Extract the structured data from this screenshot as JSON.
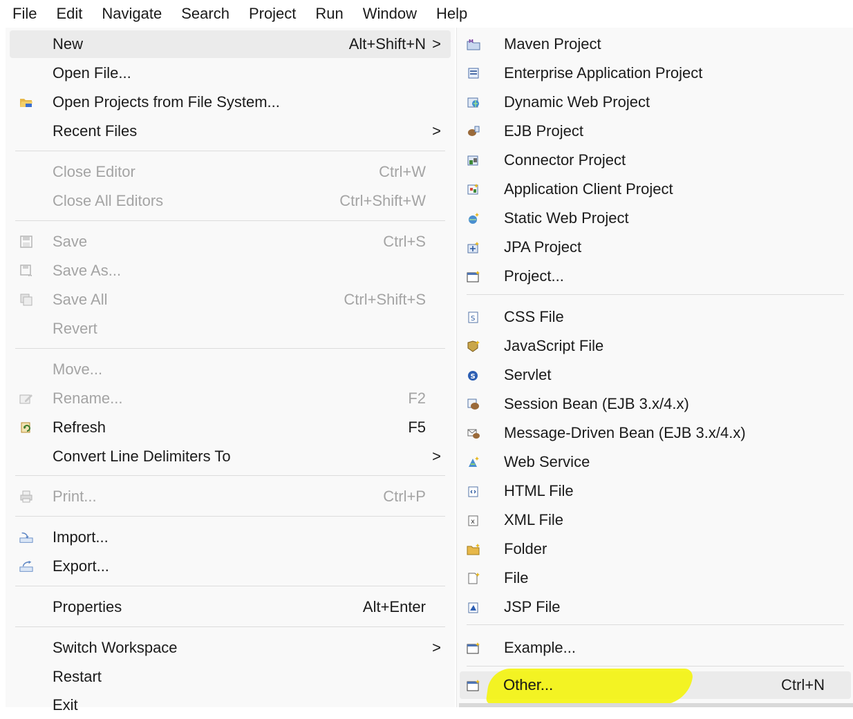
{
  "menubar": [
    "File",
    "Edit",
    "Navigate",
    "Search",
    "Project",
    "Run",
    "Window",
    "Help"
  ],
  "file_menu": {
    "new": {
      "label": "New",
      "shortcut": "Alt+Shift+N"
    },
    "open_file": {
      "label": "Open File..."
    },
    "open_projects": {
      "label": "Open Projects from File System..."
    },
    "recent_files": {
      "label": "Recent Files"
    },
    "close_editor": {
      "label": "Close Editor",
      "shortcut": "Ctrl+W"
    },
    "close_all": {
      "label": "Close All Editors",
      "shortcut": "Ctrl+Shift+W"
    },
    "save": {
      "label": "Save",
      "shortcut": "Ctrl+S"
    },
    "save_as": {
      "label": "Save As..."
    },
    "save_all": {
      "label": "Save All",
      "shortcut": "Ctrl+Shift+S"
    },
    "revert": {
      "label": "Revert"
    },
    "move": {
      "label": "Move..."
    },
    "rename": {
      "label": "Rename...",
      "shortcut": "F2"
    },
    "refresh": {
      "label": "Refresh",
      "shortcut": "F5"
    },
    "convert": {
      "label": "Convert Line Delimiters To"
    },
    "print": {
      "label": "Print...",
      "shortcut": "Ctrl+P"
    },
    "import": {
      "label": "Import..."
    },
    "export": {
      "label": "Export..."
    },
    "properties": {
      "label": "Properties",
      "shortcut": "Alt+Enter"
    },
    "switch_workspace": {
      "label": "Switch Workspace"
    },
    "restart": {
      "label": "Restart"
    },
    "exit": {
      "label": "Exit"
    }
  },
  "new_submenu": {
    "maven": {
      "label": "Maven Project"
    },
    "enterprise": {
      "label": "Enterprise Application Project"
    },
    "dynamic_web": {
      "label": "Dynamic Web Project"
    },
    "ejb": {
      "label": "EJB Project"
    },
    "connector": {
      "label": "Connector Project"
    },
    "app_client": {
      "label": "Application Client Project"
    },
    "static_web": {
      "label": "Static Web Project"
    },
    "jpa": {
      "label": "JPA Project"
    },
    "project": {
      "label": "Project..."
    },
    "css": {
      "label": "CSS File"
    },
    "javascript": {
      "label": "JavaScript File"
    },
    "servlet": {
      "label": "Servlet"
    },
    "session_bean": {
      "label": "Session Bean (EJB 3.x/4.x)"
    },
    "mdb": {
      "label": "Message-Driven Bean (EJB 3.x/4.x)"
    },
    "web_service": {
      "label": "Web Service"
    },
    "html": {
      "label": "HTML File"
    },
    "xml": {
      "label": "XML File"
    },
    "folder": {
      "label": "Folder"
    },
    "file": {
      "label": "File"
    },
    "jsp": {
      "label": "JSP File"
    },
    "example": {
      "label": "Example..."
    },
    "other": {
      "label": "Other...",
      "shortcut": "Ctrl+N"
    }
  },
  "submenu_arrow": ">",
  "colors": {
    "highlight_marker": "#f4f400",
    "menu_bg": "#f9f9f9",
    "disabled_text": "#a4a4a4"
  }
}
